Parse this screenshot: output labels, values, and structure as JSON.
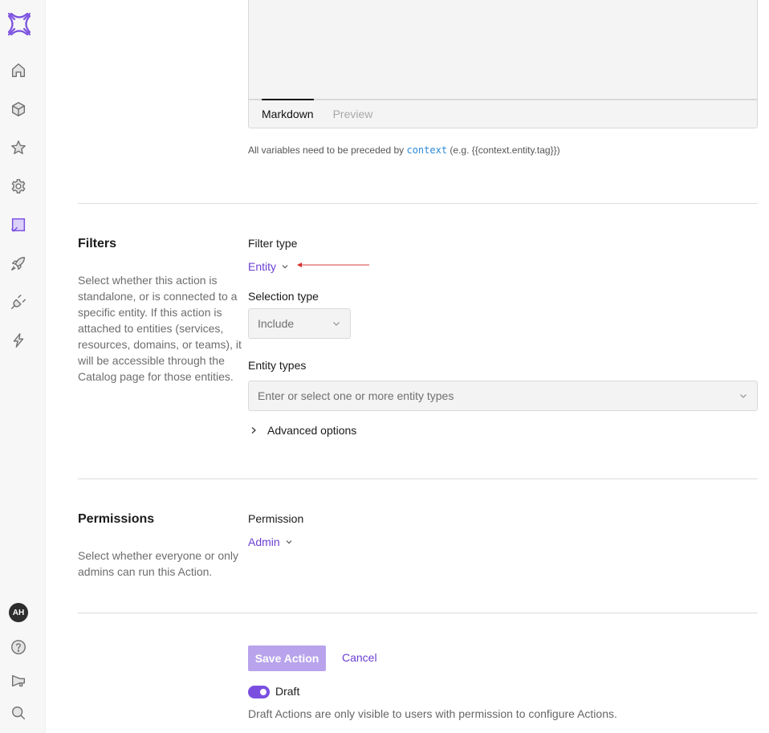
{
  "sidebar": {
    "logo": "app-logo",
    "items": [
      {
        "name": "home-icon",
        "active": false
      },
      {
        "name": "cube-icon",
        "active": false
      },
      {
        "name": "star-icon",
        "active": false
      },
      {
        "name": "gear-icon",
        "active": false
      },
      {
        "name": "checkbox-icon",
        "active": true
      },
      {
        "name": "rocket-icon",
        "active": false
      },
      {
        "name": "plug-icon",
        "active": false
      },
      {
        "name": "lightning-icon",
        "active": false
      }
    ],
    "avatar_initials": "AH",
    "bottom_items": [
      {
        "name": "help-icon"
      },
      {
        "name": "megaphone-icon"
      },
      {
        "name": "search-icon"
      }
    ],
    "accent_color": "#7a4fe0"
  },
  "editor": {
    "tabs": [
      {
        "label": "Markdown",
        "active": true
      },
      {
        "label": "Preview",
        "active": false
      }
    ],
    "hint_prefix": "All variables need to be preceded by",
    "hint_code": "context",
    "hint_suffix": "(e.g. {{context.entity.tag}})"
  },
  "filters": {
    "title": "Filters",
    "description": "Select whether this action is standalone, or is connected to a specific entity. If this action is attached to entities (services, resources, domains, or teams), it will be accessible through the Catalog page for those entities.",
    "filter_type_label": "Filter type",
    "filter_type_value": "Entity",
    "selection_type_label": "Selection type",
    "selection_type_value": "Include",
    "entity_types_label": "Entity types",
    "entity_types_placeholder": "Enter or select one or more entity types",
    "advanced_options_label": "Advanced options"
  },
  "permissions": {
    "title": "Permissions",
    "description": "Select whether everyone or only admins can run this Action.",
    "permission_label": "Permission",
    "permission_value": "Admin"
  },
  "footer": {
    "save_label": "Save Action",
    "cancel_label": "Cancel",
    "draft_label": "Draft",
    "draft_enabled": true,
    "draft_description": "Draft Actions are only visible to users with permission to configure Actions."
  }
}
